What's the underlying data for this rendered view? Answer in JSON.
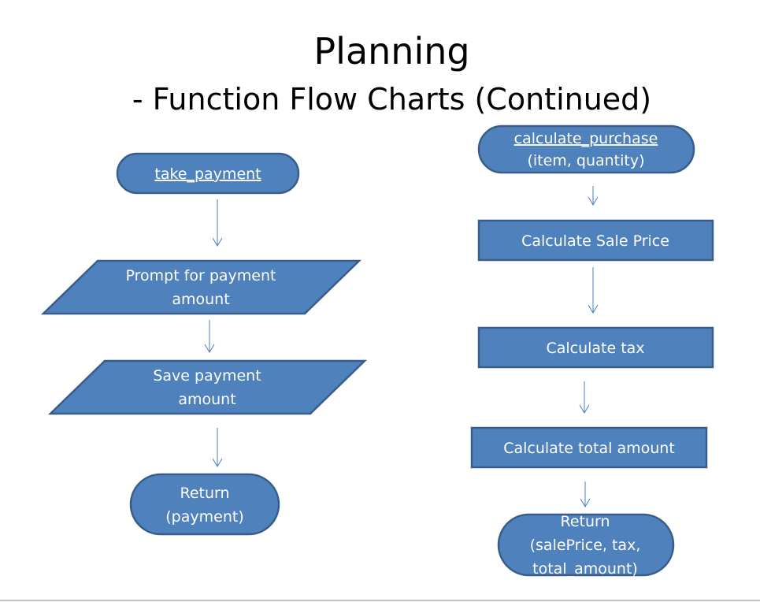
{
  "slide": {
    "title": "Planning",
    "subtitle": "- Function Flow Charts (Continued)"
  },
  "colors": {
    "fill": "#4f81bd",
    "stroke": "#385d8a",
    "arrow": "#4a7ebb",
    "text": "#ffffff"
  },
  "left_flow": {
    "start": {
      "shape": "terminator",
      "lines": [
        "take_payment"
      ]
    },
    "steps": [
      {
        "shape": "parallelogram",
        "lines": [
          "Prompt for payment",
          "amount"
        ]
      },
      {
        "shape": "parallelogram",
        "lines": [
          "Save payment",
          "amount"
        ]
      }
    ],
    "end": {
      "shape": "terminator",
      "lines": [
        "Return",
        "(payment)"
      ]
    }
  },
  "right_flow": {
    "start": {
      "shape": "terminator",
      "lines": [
        "calculate_purchase",
        "(item, quantity)"
      ]
    },
    "steps": [
      {
        "shape": "process",
        "lines": [
          "Calculate Sale Price"
        ]
      },
      {
        "shape": "process",
        "lines": [
          "Calculate tax"
        ]
      },
      {
        "shape": "process",
        "lines": [
          "Calculate total amount"
        ]
      }
    ],
    "end": {
      "shape": "terminator",
      "lines": [
        "Return",
        "(salePrice, tax,",
        "total_amount)"
      ]
    }
  }
}
